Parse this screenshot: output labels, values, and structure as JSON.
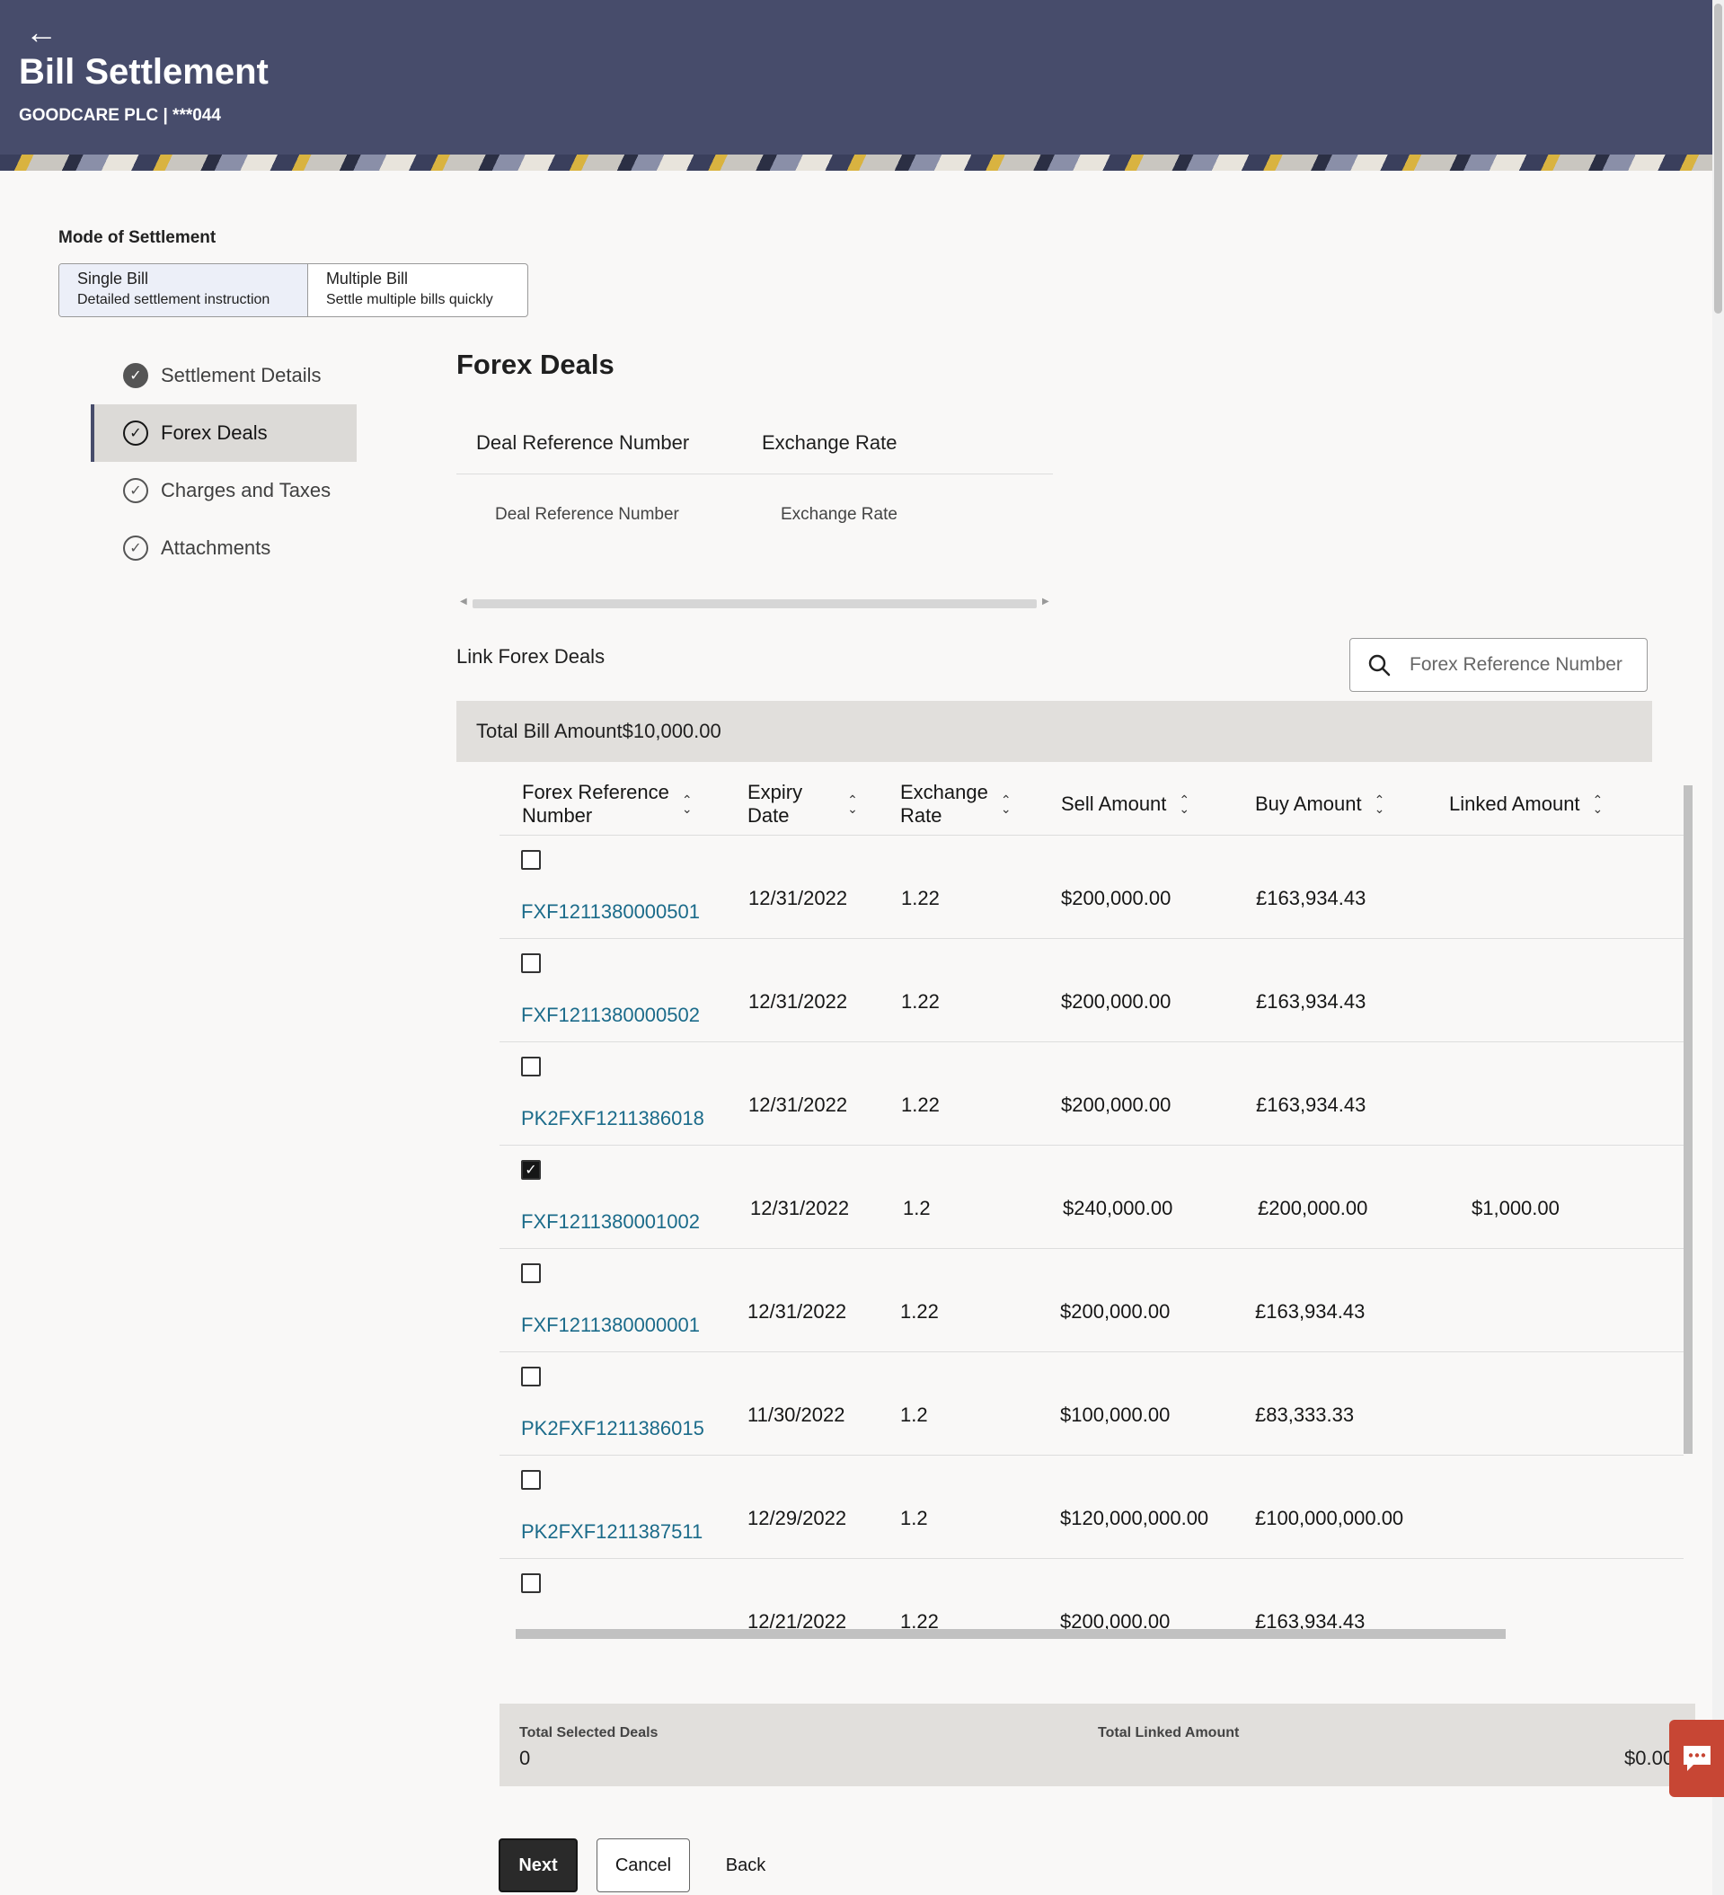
{
  "header": {
    "back_icon": "back-arrow-icon",
    "title": "Bill Settlement",
    "subtitle": "GOODCARE PLC | ***044"
  },
  "mode": {
    "label": "Mode of Settlement",
    "options": [
      {
        "title": "Single Bill",
        "desc": "Detailed settlement instruction",
        "selected": true
      },
      {
        "title": "Multiple Bill",
        "desc": "Settle multiple bills quickly",
        "selected": false
      }
    ]
  },
  "stepper": {
    "steps": [
      {
        "label": "Settlement Details",
        "state": "completed"
      },
      {
        "label": "Forex Deals",
        "state": "active"
      },
      {
        "label": "Charges and Taxes",
        "state": "pending"
      },
      {
        "label": "Attachments",
        "state": "pending"
      }
    ]
  },
  "forex": {
    "title": "Forex Deals",
    "columns": [
      "Deal Reference Number",
      "Exchange Rate"
    ],
    "placeholders": [
      "Deal Reference Number",
      "Exchange Rate"
    ]
  },
  "link_deals": {
    "label": "Link Forex Deals",
    "search_placeholder": "Forex Reference Number",
    "total_bill": "Total Bill Amount$10,000.00"
  },
  "table": {
    "headers": {
      "ref": [
        "Forex Reference",
        "Number"
      ],
      "expiry": [
        "Expiry",
        "Date"
      ],
      "rate": [
        "Exchange",
        "Rate"
      ],
      "sell": "Sell Amount",
      "buy": "Buy Amount",
      "linked": "Linked Amount"
    },
    "rows": [
      {
        "ref": "FXF1211380000501",
        "expiry": "12/31/2022",
        "rate": "1.22",
        "sell": "$200,000.00",
        "buy": "£163,934.43",
        "linked": "",
        "checked": false
      },
      {
        "ref": "FXF1211380000502",
        "expiry": "12/31/2022",
        "rate": "1.22",
        "sell": "$200,000.00",
        "buy": "£163,934.43",
        "linked": "",
        "checked": false
      },
      {
        "ref": "PK2FXF1211386018",
        "expiry": "12/31/2022",
        "rate": "1.22",
        "sell": "$200,000.00",
        "buy": "£163,934.43",
        "linked": "",
        "checked": false
      },
      {
        "ref": "FXF1211380001002",
        "expiry": "12/31/2022",
        "rate": "1.2",
        "sell": "$240,000.00",
        "buy": "£200,000.00",
        "linked": "$1,000.00",
        "checked": true
      },
      {
        "ref": "FXF1211380000001",
        "expiry": "12/31/2022",
        "rate": "1.22",
        "sell": "$200,000.00",
        "buy": "£163,934.43",
        "linked": "",
        "checked": false
      },
      {
        "ref": "PK2FXF1211386015",
        "expiry": "11/30/2022",
        "rate": "1.2",
        "sell": "$100,000.00",
        "buy": "£83,333.33",
        "linked": "",
        "checked": false
      },
      {
        "ref": "PK2FXF1211387511",
        "expiry": "12/29/2022",
        "rate": "1.2",
        "sell": "$120,000,000.00",
        "buy": "£100,000,000.00",
        "linked": "",
        "checked": false
      },
      {
        "ref": "",
        "expiry": "12/21/2022",
        "rate": "1.22",
        "sell": "$200,000.00",
        "buy": "£163,934.43",
        "linked": "",
        "checked": false
      }
    ]
  },
  "summary": {
    "selected_label": "Total Selected Deals",
    "selected_value": "0",
    "linked_label": "Total Linked Amount",
    "linked_value": "$0.00"
  },
  "actions": {
    "next": "Next",
    "cancel": "Cancel",
    "back": "Back"
  },
  "colors": {
    "header_bg": "#474c6b",
    "link": "#1b6b8a",
    "chat_button": "#c74634"
  }
}
